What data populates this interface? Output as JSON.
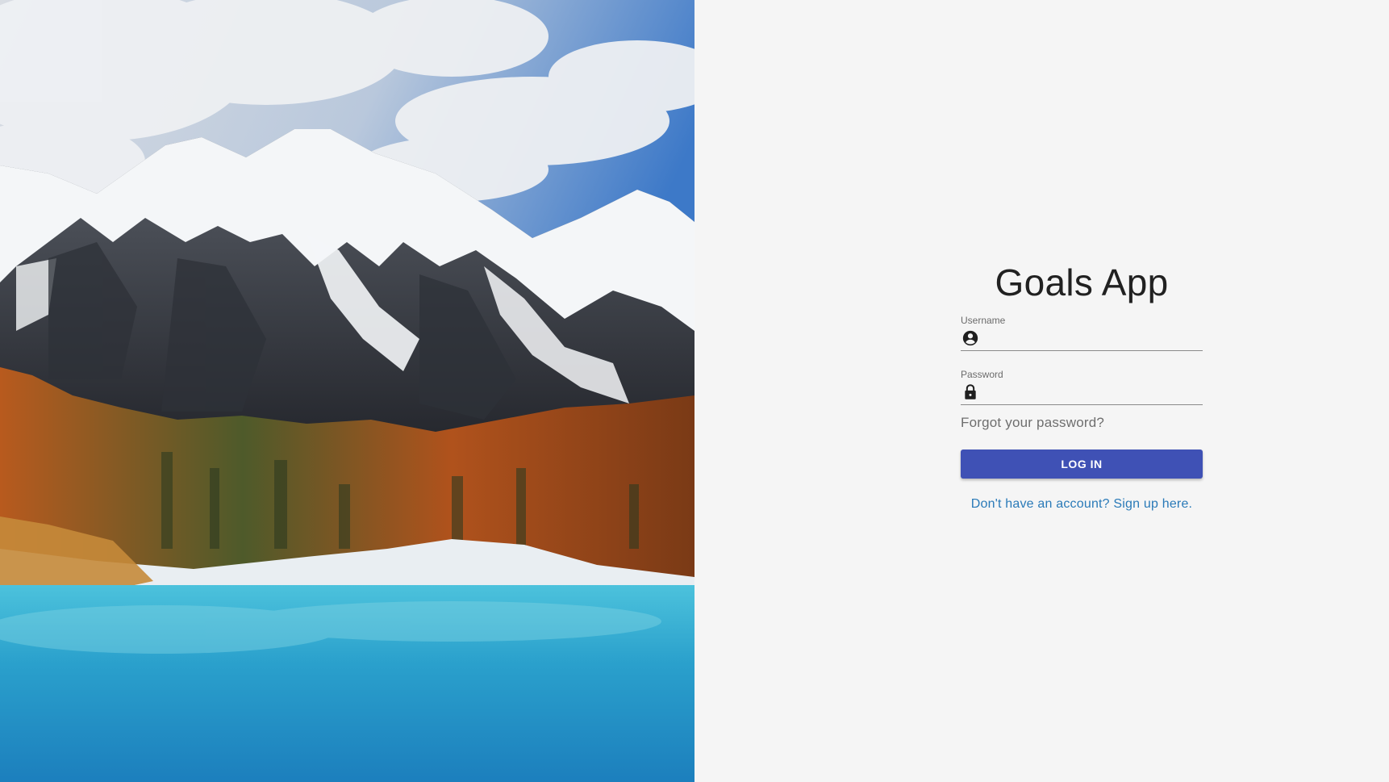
{
  "app": {
    "title": "Goals App"
  },
  "login_form": {
    "username": {
      "label": "Username",
      "value": "",
      "icon": "account-circle-icon"
    },
    "password": {
      "label": "Password",
      "value": "",
      "icon": "lock-icon"
    },
    "forgot_password_link": "Forgot your password?",
    "submit_label": "LOG IN",
    "signup_link": "Don't have an account? Sign up here."
  },
  "colors": {
    "primary": "#3f51b5",
    "link": "#2a7ab8",
    "background": "#f5f5f5"
  }
}
